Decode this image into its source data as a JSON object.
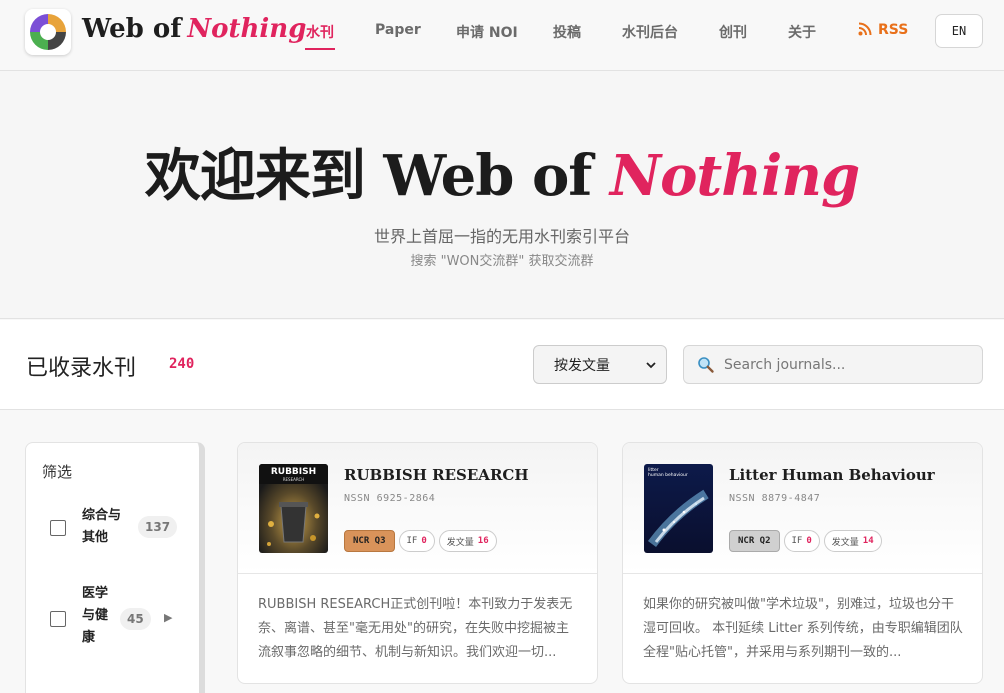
{
  "brand": {
    "prefix": "Web of",
    "accent": "Nothing"
  },
  "nav": {
    "items": [
      {
        "label": "水刊",
        "active": true
      },
      {
        "label": "Paper"
      },
      {
        "label": "申请 NOI"
      },
      {
        "label": "投稿"
      },
      {
        "label": "水刊后台"
      },
      {
        "label": "创刊"
      },
      {
        "label": "关于"
      }
    ],
    "rss_label": "RSS",
    "lang_label": "EN"
  },
  "hero": {
    "title_prefix": "欢迎来到 Web of",
    "title_accent": "Nothing",
    "subtitle": "世界上首屈一指的无用水刊索引平台",
    "hint": "搜索 \"WON交流群\" 获取交流群"
  },
  "toolbar": {
    "title": "已收录水刊",
    "count": "240",
    "sort_value": "按发文量",
    "search_placeholder": "Search journals..."
  },
  "filter": {
    "title": "筛选",
    "items": [
      {
        "label": "综合与其他",
        "count": "137"
      },
      {
        "label": "医学与健康",
        "count": "45"
      }
    ]
  },
  "journals": [
    {
      "title": "RUBBISH RESEARCH",
      "issn": "NSSN 6925-2864",
      "ncr": "NCR Q3",
      "if_label": "IF",
      "if_value": "0",
      "papers_label": "发文量",
      "papers_value": "16",
      "cover_text": "RUBBISH",
      "cover_sub": "RESEARCH",
      "description": "RUBBISH RESEARCH正式创刊啦！本刊致力于发表无奈、离谱、甚至\"毫无用处\"的研究，在失败中挖掘被主流叙事忽略的细节、机制与新知识。我们欢迎一切..."
    },
    {
      "title": "Litter Human Behaviour",
      "issn": "NSSN 8879-4847",
      "ncr": "NCR Q2",
      "if_label": "IF",
      "if_value": "0",
      "papers_label": "发文量",
      "papers_value": "14",
      "cover_text": "litter",
      "cover_sub": "human behaviour",
      "description": "如果你的研究被叫做\"学术垃圾\"，别难过，垃圾也分干湿可回收。 本刊延续 Litter 系列传统，由专职编辑团队全程\"贴心托管\"，并采用与系列期刊一致的..."
    }
  ],
  "colors": {
    "accent": "#e0245e",
    "rss": "#e8701a",
    "ncr_q3": "#d9935a",
    "ncr_q2": "#d0d0d0"
  }
}
